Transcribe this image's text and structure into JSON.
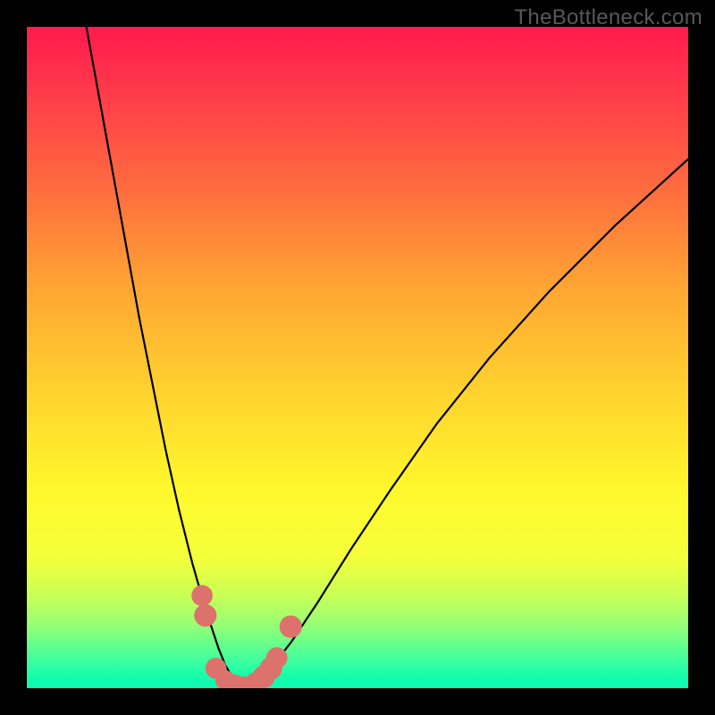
{
  "watermark": "TheBottleneck.com",
  "chart_data": {
    "type": "line",
    "title": "",
    "xlabel": "",
    "ylabel": "",
    "xlim": [
      0,
      100
    ],
    "ylim": [
      0,
      100
    ],
    "series": [
      {
        "name": "curve-left",
        "x": [
          9,
          11,
          13,
          15,
          17,
          19,
          21,
          23,
          25,
          27,
          29,
          30,
          31,
          32,
          33
        ],
        "values": [
          100,
          89,
          78,
          67,
          56,
          46,
          36,
          27,
          19,
          12,
          6,
          3.5,
          1.8,
          0.8,
          0.2
        ]
      },
      {
        "name": "curve-right",
        "x": [
          33,
          35,
          37,
          40,
          44,
          49,
          55,
          62,
          70,
          79,
          89,
          100
        ],
        "values": [
          0.2,
          1.2,
          3.2,
          7,
          13,
          21,
          30,
          40,
          50,
          60,
          70,
          80
        ]
      }
    ],
    "markers": {
      "name": "threshold-dots",
      "color": "#dd726c",
      "points": [
        {
          "x": 26.5,
          "y": 14.0,
          "r": 1.6
        },
        {
          "x": 27.0,
          "y": 11.0,
          "r": 1.7
        },
        {
          "x": 28.6,
          "y": 3.0,
          "r": 1.6
        },
        {
          "x": 30.0,
          "y": 1.2,
          "r": 1.5
        },
        {
          "x": 31.4,
          "y": 0.5,
          "r": 1.6
        },
        {
          "x": 33.0,
          "y": 0.2,
          "r": 1.6
        },
        {
          "x": 34.6,
          "y": 0.8,
          "r": 1.6
        },
        {
          "x": 35.8,
          "y": 1.7,
          "r": 1.7
        },
        {
          "x": 36.9,
          "y": 3.0,
          "r": 1.7
        },
        {
          "x": 37.8,
          "y": 4.6,
          "r": 1.6
        },
        {
          "x": 39.9,
          "y": 9.3,
          "r": 1.7
        }
      ]
    }
  }
}
